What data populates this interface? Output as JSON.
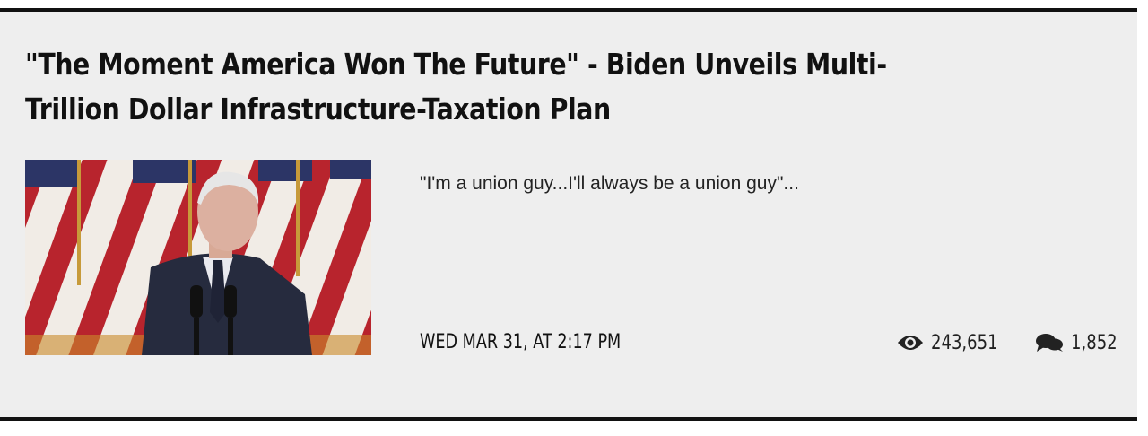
{
  "article": {
    "headline": "\"The Moment America Won The Future\" - Biden Unveils Multi-Trillion Dollar Infrastructure-Taxation Plan",
    "teaser": "\"I'm a union guy...I'll always be a union guy\"...",
    "date": "WED MAR 31, AT 2:17 PM",
    "views": "243,651",
    "comments": "1,852",
    "thumbnail_icon": "news-photo-thumbnail",
    "views_icon": "eye-icon",
    "comments_icon": "comment-bubbles-icon"
  },
  "colors": {
    "card_background": "#eeeeee",
    "border": "#111111",
    "text": "#111111"
  }
}
